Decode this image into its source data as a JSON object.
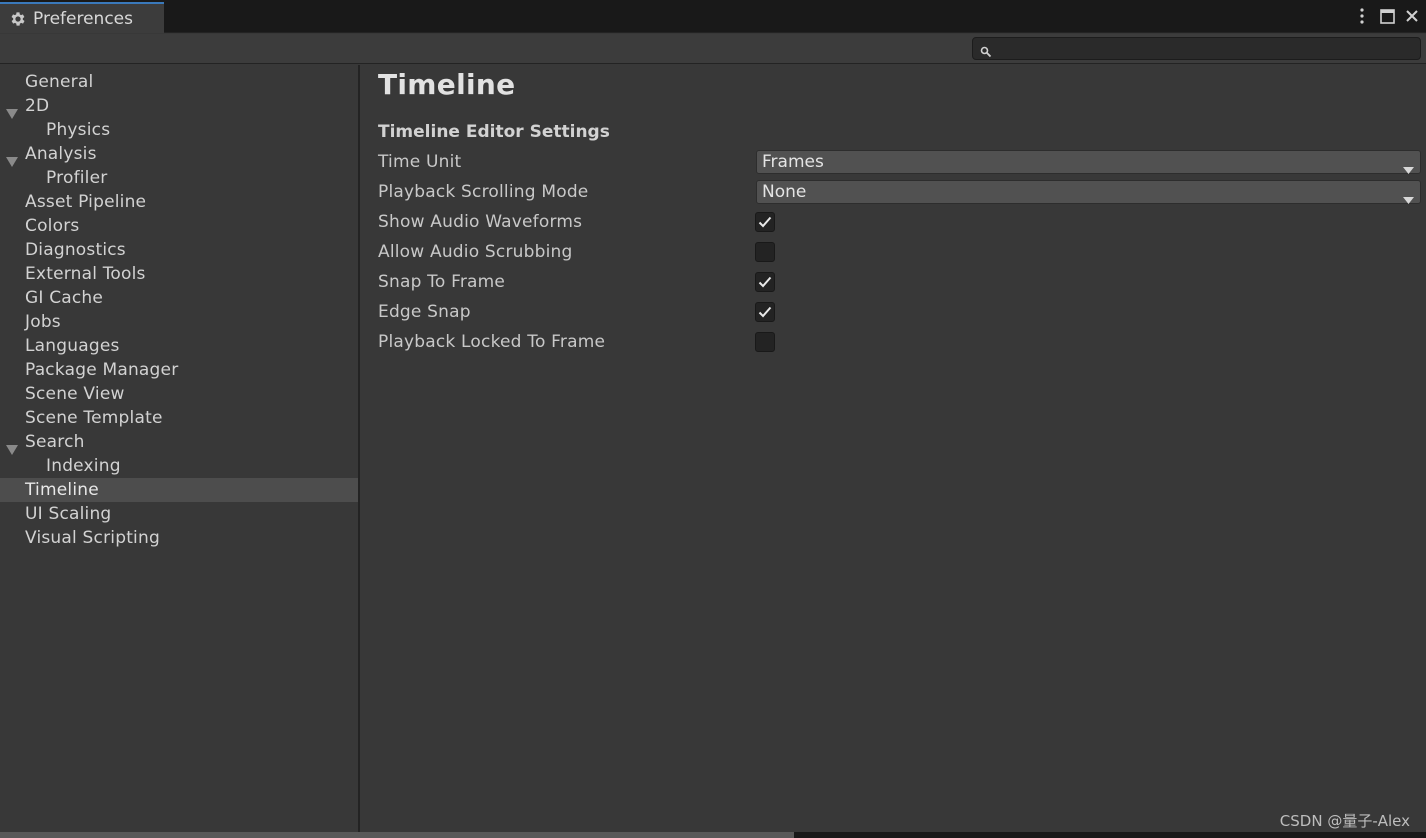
{
  "window": {
    "title": "Preferences",
    "icon": "gear-icon",
    "controls": [
      "more-icon",
      "maximize-icon",
      "close-icon"
    ]
  },
  "search": {
    "value": "",
    "placeholder": ""
  },
  "sidebar": {
    "items": [
      {
        "label": "General",
        "level": 0,
        "foldout": false,
        "selected": false
      },
      {
        "label": "2D",
        "level": 0,
        "foldout": true,
        "selected": false
      },
      {
        "label": "Physics",
        "level": 1,
        "foldout": false,
        "selected": false
      },
      {
        "label": "Analysis",
        "level": 0,
        "foldout": true,
        "selected": false
      },
      {
        "label": "Profiler",
        "level": 1,
        "foldout": false,
        "selected": false
      },
      {
        "label": "Asset Pipeline",
        "level": 0,
        "foldout": false,
        "selected": false
      },
      {
        "label": "Colors",
        "level": 0,
        "foldout": false,
        "selected": false
      },
      {
        "label": "Diagnostics",
        "level": 0,
        "foldout": false,
        "selected": false
      },
      {
        "label": "External Tools",
        "level": 0,
        "foldout": false,
        "selected": false
      },
      {
        "label": "GI Cache",
        "level": 0,
        "foldout": false,
        "selected": false
      },
      {
        "label": "Jobs",
        "level": 0,
        "foldout": false,
        "selected": false
      },
      {
        "label": "Languages",
        "level": 0,
        "foldout": false,
        "selected": false
      },
      {
        "label": "Package Manager",
        "level": 0,
        "foldout": false,
        "selected": false
      },
      {
        "label": "Scene View",
        "level": 0,
        "foldout": false,
        "selected": false
      },
      {
        "label": "Scene Template",
        "level": 0,
        "foldout": false,
        "selected": false
      },
      {
        "label": "Search",
        "level": 0,
        "foldout": true,
        "selected": false
      },
      {
        "label": "Indexing",
        "level": 1,
        "foldout": false,
        "selected": false
      },
      {
        "label": "Timeline",
        "level": 0,
        "foldout": false,
        "selected": true
      },
      {
        "label": "UI Scaling",
        "level": 0,
        "foldout": false,
        "selected": false
      },
      {
        "label": "Visual Scripting",
        "level": 0,
        "foldout": false,
        "selected": false
      }
    ]
  },
  "main": {
    "title": "Timeline",
    "section": "Timeline Editor Settings",
    "settings": {
      "time_unit": {
        "label": "Time Unit",
        "type": "dropdown",
        "value": "Frames"
      },
      "playback_scrolling_mode": {
        "label": "Playback Scrolling Mode",
        "type": "dropdown",
        "value": "None"
      },
      "show_audio_waveforms": {
        "label": "Show Audio Waveforms",
        "type": "checkbox",
        "checked": true
      },
      "allow_audio_scrubbing": {
        "label": "Allow Audio Scrubbing",
        "type": "checkbox",
        "checked": false
      },
      "snap_to_frame": {
        "label": "Snap To Frame",
        "type": "checkbox",
        "checked": true
      },
      "edge_snap": {
        "label": "Edge Snap",
        "type": "checkbox",
        "checked": true
      },
      "playback_locked_to_frame": {
        "label": "Playback Locked To Frame",
        "type": "checkbox",
        "checked": false
      }
    }
  },
  "watermark": "CSDN @量子-Alex",
  "colors": {
    "background": "#383838",
    "tabbar": "#191919",
    "selected_item": "#4d4d4d",
    "tab_accent": "#3a79bb",
    "checkbox_bg": "#232323",
    "dropdown_bg": "#515151"
  }
}
